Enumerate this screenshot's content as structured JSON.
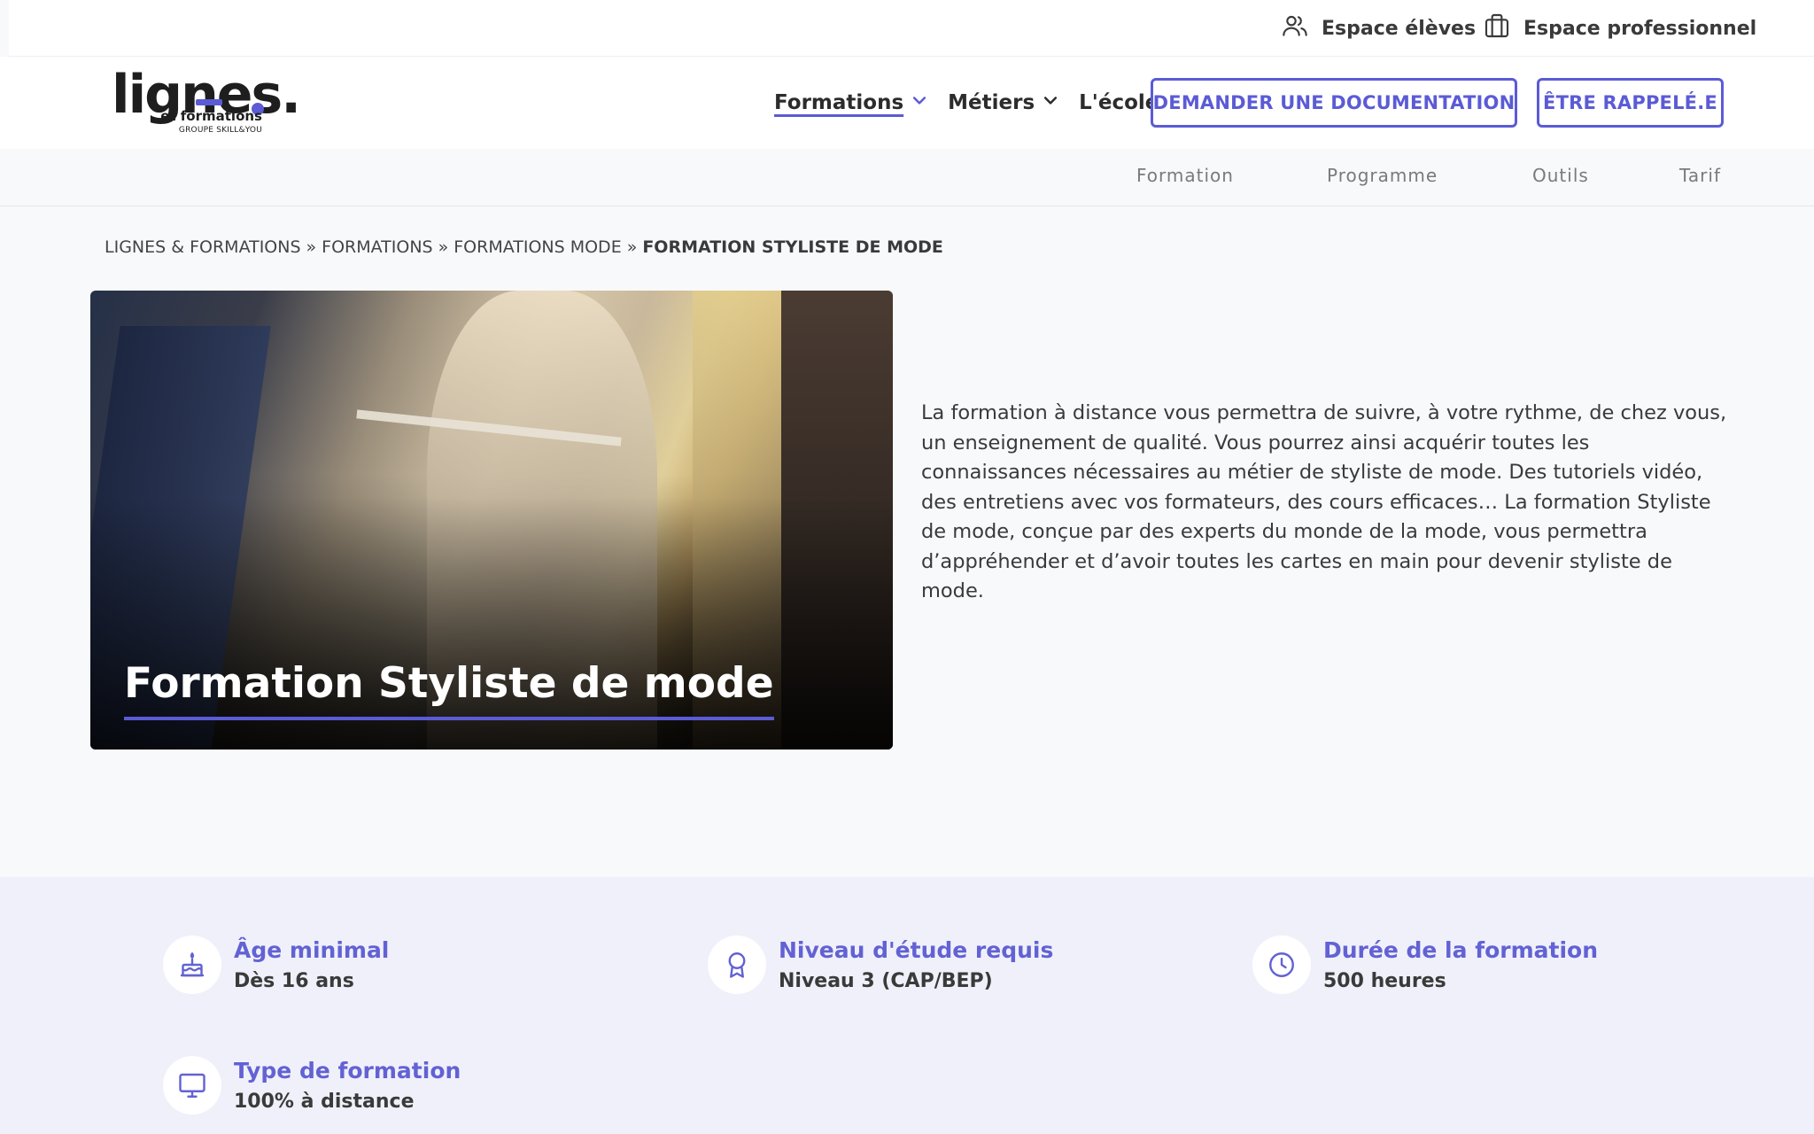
{
  "topbar": {
    "students_label": "Espace élèves",
    "students_icon": "users-icon",
    "pro_label": "Espace professionnel",
    "pro_icon": "briefcase-icon"
  },
  "logo": {
    "brand": "lignes.",
    "subtitle": "et formations",
    "group": "GROUPE SKILL&YOU"
  },
  "nav": {
    "items": [
      {
        "label": "Formations",
        "has_dropdown": true,
        "active": true
      },
      {
        "label": "Métiers",
        "has_dropdown": true,
        "active": false
      },
      {
        "label": "L'école",
        "has_dropdown": false,
        "active": false
      }
    ],
    "doc_button": "DEMANDER UNE DOCUMENTATION",
    "callback_button": "ÊTRE RAPPELÉ.E"
  },
  "subnav": {
    "items": [
      "Formation",
      "Programme",
      "Outils",
      "Tarif"
    ]
  },
  "breadcrumb": {
    "items": [
      "LIGNES & FORMATIONS",
      "FORMATIONS",
      "FORMATIONS MODE"
    ],
    "separator": "»",
    "current": "FORMATION STYLISTE DE MODE"
  },
  "hero": {
    "title": "Formation Styliste de mode"
  },
  "intro": {
    "text": "La formation à distance vous permettra de suivre, à votre rythme, de chez vous, un enseignement de qualité. Vous pourrez ainsi acquérir toutes les connaissances nécessaires au métier de styliste de mode. Des tutoriels vidéo, des entretiens avec vos formateurs, des cours efficaces… La formation Styliste de mode, conçue par des experts du monde de la mode, vous permettra d’appréhender et d’avoir toutes les cartes en main pour devenir styliste de mode."
  },
  "info": {
    "age": {
      "label": "Âge minimal",
      "value": "Dès 16 ans",
      "icon": "cake-icon"
    },
    "level": {
      "label": "Niveau d'étude requis",
      "value": "Niveau 3 (CAP/BEP)",
      "icon": "award-icon"
    },
    "duration": {
      "label": "Durée de la formation",
      "value": "500 heures",
      "icon": "clock-icon"
    },
    "type": {
      "label": "Type de formation",
      "value": "100% à distance",
      "icon": "monitor-icon"
    }
  },
  "colors": {
    "accent": "#5b5bd6",
    "info_band": "#f0f0fb",
    "text": "#3a3a3a"
  }
}
